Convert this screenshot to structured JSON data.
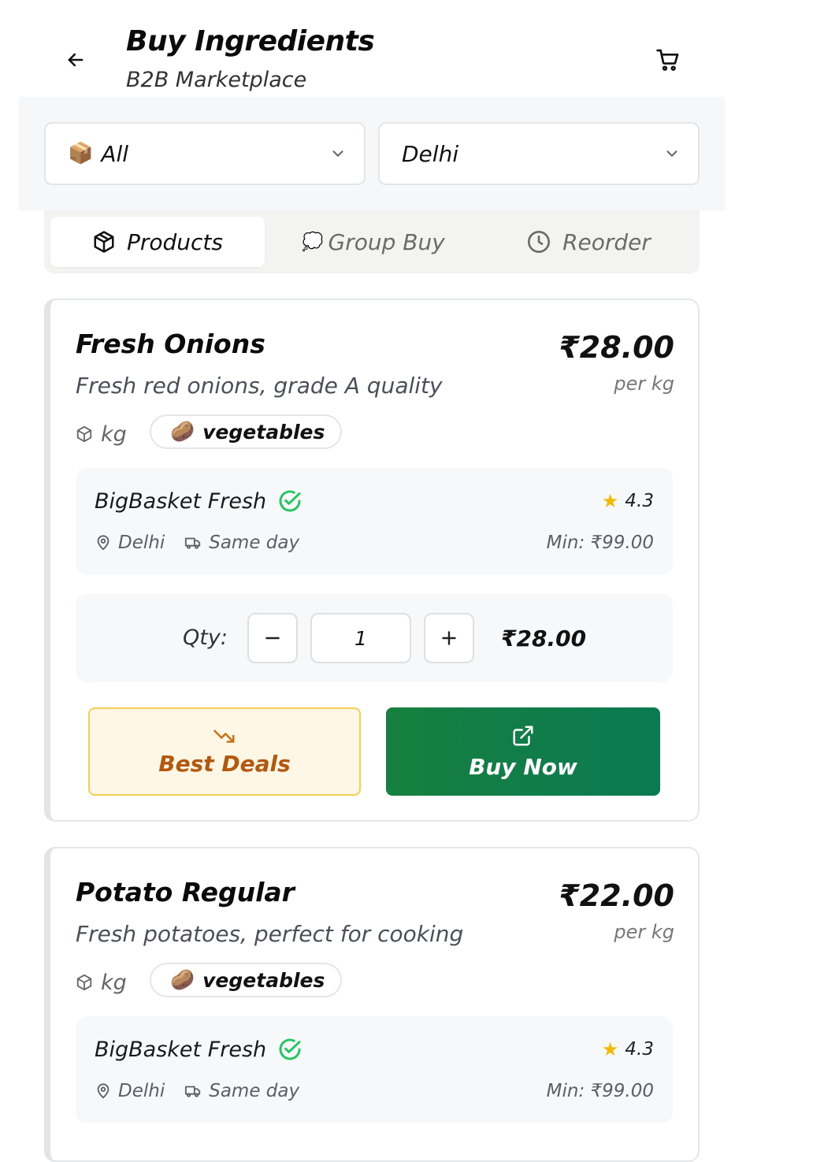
{
  "header": {
    "title": "Buy Ingredients",
    "subtitle": "B2B Marketplace"
  },
  "filters": {
    "category": {
      "emoji": "📦",
      "value": "All"
    },
    "city": {
      "value": "Delhi"
    }
  },
  "tabs": [
    {
      "label": "Products",
      "icon": "box-icon",
      "active": true
    },
    {
      "label": "Group Buy",
      "icon": "speech-bubble-icon",
      "emoji": "💭",
      "active": false
    },
    {
      "label": "Reorder",
      "icon": "clock-icon",
      "active": false
    }
  ],
  "products": [
    {
      "name": "Fresh Onions",
      "description": "Fresh red onions, grade A quality",
      "price": "₹28.00",
      "unit_label": "per kg",
      "unit": "kg",
      "category_emoji": "🥔",
      "category": "vegetables",
      "supplier": {
        "name": "BigBasket Fresh",
        "rating": "4.3",
        "city": "Delhi",
        "delivery": "Same day",
        "min_order": "Min: ₹99.00"
      },
      "qty_label": "Qty:",
      "qty": "1",
      "qty_total": "₹28.00",
      "deals_label": "Best Deals",
      "buy_label": "Buy Now"
    },
    {
      "name": "Potato Regular",
      "description": "Fresh potatoes, perfect for cooking",
      "price": "₹22.00",
      "unit_label": "per kg",
      "unit": "kg",
      "category_emoji": "🥔",
      "category": "vegetables",
      "supplier": {
        "name": "BigBasket Fresh",
        "rating": "4.3",
        "city": "Delhi",
        "delivery": "Same day",
        "min_order": "Min: ₹99.00"
      }
    }
  ],
  "colors": {
    "accent_green": "#17803f",
    "verified_green": "#22c55e",
    "deals_orange": "#b4580e",
    "deals_border": "#f7cf52",
    "star": "#f5b800"
  }
}
